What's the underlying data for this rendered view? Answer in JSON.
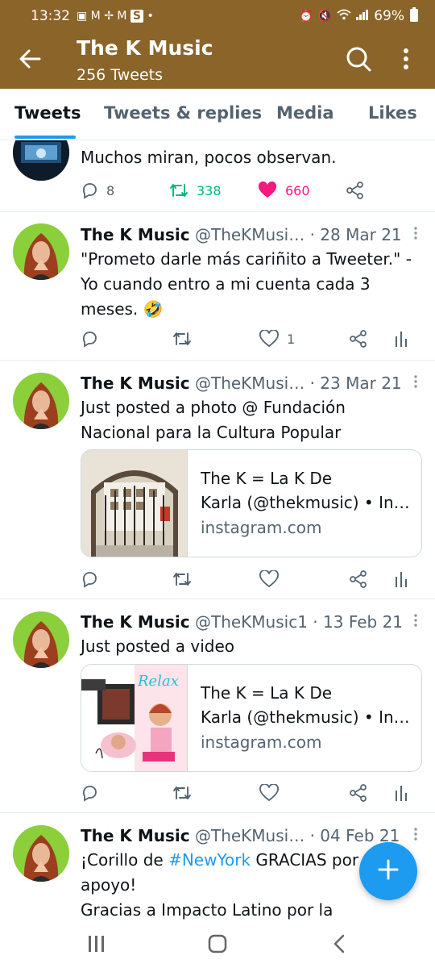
{
  "status_bar": {
    "time": "13:32",
    "battery": "69%"
  },
  "header": {
    "title": "The K Music",
    "subtitle": "256 Tweets"
  },
  "tabs": [
    {
      "label": "Tweets",
      "active": true
    },
    {
      "label": "Tweets & replies",
      "active": false
    },
    {
      "label": "Media",
      "active": false
    },
    {
      "label": "Likes",
      "active": false
    }
  ],
  "tweets": [
    {
      "text": "Muchos miran, pocos observan.",
      "stats": {
        "replies": "8",
        "retweets": "338",
        "likes": "660"
      },
      "colors": {
        "retweet": "#00ba7c",
        "like": "#f91880"
      }
    },
    {
      "name": "The K Music",
      "handle": "@TheKMusi…",
      "date": "· 28 Mar 21",
      "text": "\"Prometo darle más cariñito a Tweeter.\" -Yo cuando entro a mi cuenta cada 3 meses. 🤣",
      "stats": {
        "likes": "1"
      }
    },
    {
      "name": "The K Music",
      "handle": "@TheKMusi…",
      "date": "· 23 Mar 21",
      "text": "Just posted a photo @ Fundación Nacional para la Cultura Popular",
      "card": {
        "title_line1": "The K = La K De",
        "title_line2": "Karla (@thekmusic) • In…",
        "domain": "instagram.com"
      }
    },
    {
      "name": "The K Music",
      "handle": "@TheKMusic1",
      "date": "· 13 Feb 21",
      "text": "Just posted a video",
      "card": {
        "title_line1": "The K = La K De",
        "title_line2": "Karla (@thekmusic) • In…",
        "domain": "instagram.com"
      }
    },
    {
      "name": "The K Music",
      "handle": "@TheKMusi…",
      "date": "· 04 Feb 21",
      "text_before": "¡Corillo de ",
      "hashtag": "#NewYork",
      "text_after": " GRACIAS por el apoyo!",
      "text_line3": "Gracias a Impacto Latino por la"
    }
  ],
  "theme": {
    "header_bg": "#8b6429",
    "accent": "#1d9bf0"
  }
}
